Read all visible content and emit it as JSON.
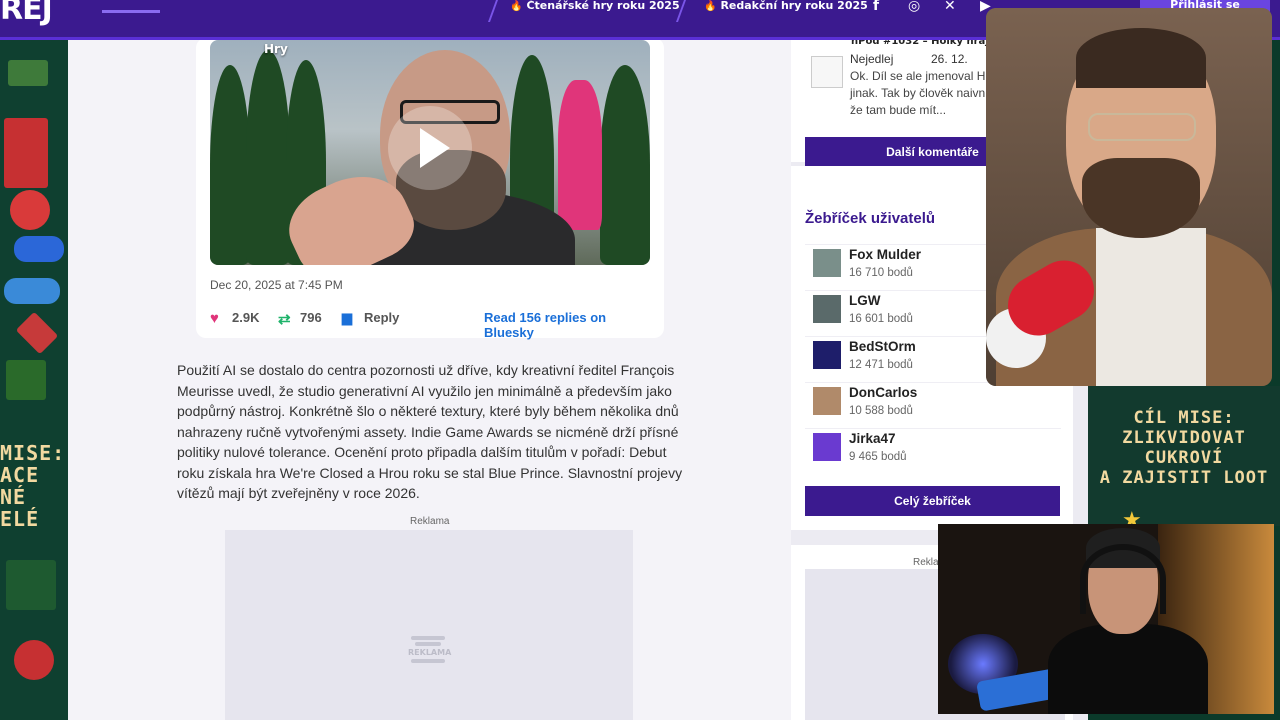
{
  "site": {
    "logo": "REJ"
  },
  "nav": {
    "links": [
      {
        "label": "Čtenářské hry roku 2025"
      },
      {
        "label": "Redakční hry roku 2025"
      }
    ],
    "social_icons": [
      "facebook-icon",
      "instagram-icon",
      "x-icon",
      "youtube-icon"
    ],
    "login_label": "Přihlásit se"
  },
  "embed": {
    "video_label": "Hry",
    "date": "Dec 20, 2025 at 7:45 PM",
    "likes": "2.9K",
    "reposts": "796",
    "reply_label": "Reply",
    "read_replies": "Read 156 replies on Bluesky"
  },
  "article": {
    "paragraph": "Použití AI se dostalo do centra pozornosti už dříve, kdy kreativní ředitel François Meurisse uvedl, že studio generativní AI využilo jen minimálně a především jako podpůrný nástroj. Konkrétně šlo o některé textury, které byly během několika dnů nahrazeny ručně vytvořenými assety. Indie Game Awards se nicméně drží přísné politiky nulové tolerance. Ocenění proto připadla dalším titulům v pořadí: Debut roku získala hra We're Closed a Hrou roku se stal Blue Prince. Slavnostní projevy vítězů mají být zveřejněny v roce 2026."
  },
  "ad": {
    "label": "Reklama",
    "logo_text": "REKLAMA"
  },
  "sidebar": {
    "comment": {
      "title": "hPod #1032 – Holky hrají",
      "user": "Nejedlej",
      "date": "26. 12.",
      "text": "Ok. Díl se ale jmenoval H jinak. Tak by člověk naivn že tam bude mít..."
    },
    "more_comments_label": "Další komentáře",
    "ranking": {
      "title": "Žebříček uživatelů",
      "users": [
        {
          "name": "Fox Mulder",
          "points": "16 710 bodů"
        },
        {
          "name": "LGW",
          "points": "16 601 bodů"
        },
        {
          "name": "BedStOrm",
          "points": "12 471 bodů"
        },
        {
          "name": "DonCarlos",
          "points": "10 588 bodů"
        },
        {
          "name": "Jirka47",
          "points": "9 465 bodů"
        }
      ],
      "full_label": "Celý žebříček"
    },
    "ad_label": "Reklama"
  },
  "background": {
    "mission_left": [
      "MISE:",
      "ACE",
      "NÉ",
      "ELÉ"
    ],
    "mission_right": [
      "CÍL MISE:",
      "ZLIKVIDOVAT",
      "CUKROVÍ",
      "A ZAJISTIT LOOT"
    ]
  },
  "colors": {
    "nav": "#3b1a8f",
    "accent": "#5a2fd6",
    "heart": "#e0357a",
    "repost": "#1fb36a",
    "link": "#1a6fd8"
  }
}
